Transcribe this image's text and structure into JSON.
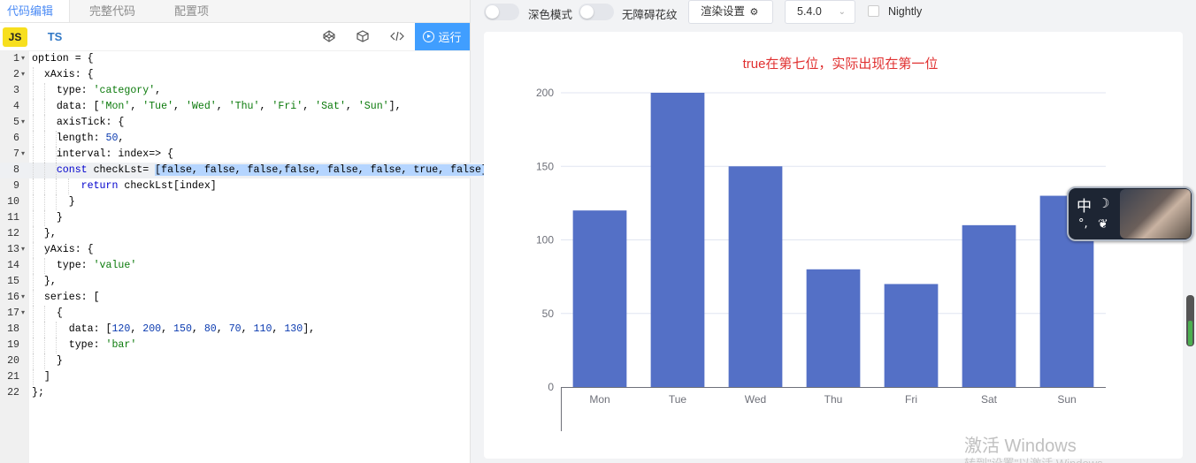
{
  "tabs": [
    "代码编辑",
    "完整代码",
    "配置项"
  ],
  "lang": {
    "js": "JS",
    "ts": "TS"
  },
  "toolbar": {
    "run_label": "运行"
  },
  "editor": {
    "current_line": 8,
    "lines": [
      {
        "n": "1",
        "fold": true,
        "indent": 0,
        "code": [
          [
            "p",
            "option = {"
          ]
        ]
      },
      {
        "n": "2",
        "fold": true,
        "indent": 1,
        "code": [
          [
            "p",
            "  xAxis: {"
          ]
        ]
      },
      {
        "n": "3",
        "fold": false,
        "indent": 2,
        "code": [
          [
            "p",
            "    type: "
          ],
          [
            "s",
            "'category'"
          ],
          [
            "p",
            ","
          ]
        ]
      },
      {
        "n": "4",
        "fold": false,
        "indent": 2,
        "code": [
          [
            "p",
            "    data: ["
          ],
          [
            "s",
            "'Mon'"
          ],
          [
            "p",
            ", "
          ],
          [
            "s",
            "'Tue'"
          ],
          [
            "p",
            ", "
          ],
          [
            "s",
            "'Wed'"
          ],
          [
            "p",
            ", "
          ],
          [
            "s",
            "'Thu'"
          ],
          [
            "p",
            ", "
          ],
          [
            "s",
            "'Fri'"
          ],
          [
            "p",
            ", "
          ],
          [
            "s",
            "'Sat'"
          ],
          [
            "p",
            ", "
          ],
          [
            "s",
            "'Sun'"
          ],
          [
            "p",
            "],"
          ]
        ]
      },
      {
        "n": "5",
        "fold": true,
        "indent": 2,
        "code": [
          [
            "p",
            "    axisTick: {"
          ]
        ]
      },
      {
        "n": "6",
        "fold": false,
        "indent": 3,
        "code": [
          [
            "p",
            "    length: "
          ],
          [
            "n",
            "50"
          ],
          [
            "p",
            ","
          ]
        ]
      },
      {
        "n": "7",
        "fold": true,
        "indent": 3,
        "code": [
          [
            "p",
            "    interval: index=> {"
          ]
        ]
      },
      {
        "n": "8",
        "fold": false,
        "indent": 3,
        "code": [
          [
            "p",
            "    "
          ],
          [
            "k",
            "const"
          ],
          [
            "p",
            " checkLst= "
          ],
          [
            "x",
            "[false, false, false,false, false, false, true, false]"
          ]
        ]
      },
      {
        "n": "9",
        "fold": false,
        "indent": 4,
        "code": [
          [
            "p",
            "        "
          ],
          [
            "k",
            "return"
          ],
          [
            "p",
            " checkLst[index]"
          ]
        ]
      },
      {
        "n": "10",
        "fold": false,
        "indent": 3,
        "code": [
          [
            "p",
            "      }"
          ]
        ]
      },
      {
        "n": "11",
        "fold": false,
        "indent": 2,
        "code": [
          [
            "p",
            "    }"
          ]
        ]
      },
      {
        "n": "12",
        "fold": false,
        "indent": 1,
        "code": [
          [
            "p",
            "  },"
          ]
        ]
      },
      {
        "n": "13",
        "fold": true,
        "indent": 1,
        "code": [
          [
            "p",
            "  yAxis: {"
          ]
        ]
      },
      {
        "n": "14",
        "fold": false,
        "indent": 2,
        "code": [
          [
            "p",
            "    type: "
          ],
          [
            "s",
            "'value'"
          ]
        ]
      },
      {
        "n": "15",
        "fold": false,
        "indent": 1,
        "code": [
          [
            "p",
            "  },"
          ]
        ]
      },
      {
        "n": "16",
        "fold": true,
        "indent": 1,
        "code": [
          [
            "p",
            "  series: ["
          ]
        ]
      },
      {
        "n": "17",
        "fold": true,
        "indent": 2,
        "code": [
          [
            "p",
            "    {"
          ]
        ]
      },
      {
        "n": "18",
        "fold": false,
        "indent": 3,
        "code": [
          [
            "p",
            "      data: ["
          ],
          [
            "n",
            "120"
          ],
          [
            "p",
            ", "
          ],
          [
            "n",
            "200"
          ],
          [
            "p",
            ", "
          ],
          [
            "n",
            "150"
          ],
          [
            "p",
            ", "
          ],
          [
            "n",
            "80"
          ],
          [
            "p",
            ", "
          ],
          [
            "n",
            "70"
          ],
          [
            "p",
            ", "
          ],
          [
            "n",
            "110"
          ],
          [
            "p",
            ", "
          ],
          [
            "n",
            "130"
          ],
          [
            "p",
            "],"
          ]
        ]
      },
      {
        "n": "19",
        "fold": false,
        "indent": 3,
        "code": [
          [
            "p",
            "      type: "
          ],
          [
            "s",
            "'bar'"
          ]
        ]
      },
      {
        "n": "20",
        "fold": false,
        "indent": 2,
        "code": [
          [
            "p",
            "    }"
          ]
        ]
      },
      {
        "n": "21",
        "fold": false,
        "indent": 1,
        "code": [
          [
            "p",
            "  ]"
          ]
        ]
      },
      {
        "n": "22",
        "fold": false,
        "indent": 0,
        "code": [
          [
            "p",
            "};"
          ]
        ]
      }
    ]
  },
  "topbar": {
    "dark_mode_label": "深色模式",
    "aria_label": "无障碍花纹",
    "render_settings_label": "渲染设置",
    "version": "5.4.0",
    "nightly_label": "Nightly"
  },
  "chart_data": {
    "type": "bar",
    "title": "true在第七位，实际出现在第一位",
    "categories": [
      "Mon",
      "Tue",
      "Wed",
      "Thu",
      "Fri",
      "Sat",
      "Sun"
    ],
    "values": [
      120,
      200,
      150,
      80,
      70,
      110,
      130
    ],
    "ylim": [
      0,
      200
    ],
    "yticks": [
      0,
      50,
      100,
      150,
      200
    ],
    "bar_color": "#5470c6",
    "title_color": "#e03030",
    "grid": true
  },
  "ime": {
    "lang": "中",
    "moon": "☽",
    "punct": "°,",
    "butterfly": "❦"
  },
  "watermark": {
    "line1": "激活 Windows",
    "line2": "转到\"设置\"以激活 Windows。"
  },
  "colors": {
    "accent": "#409eff",
    "js_badge": "#f7df1e"
  }
}
